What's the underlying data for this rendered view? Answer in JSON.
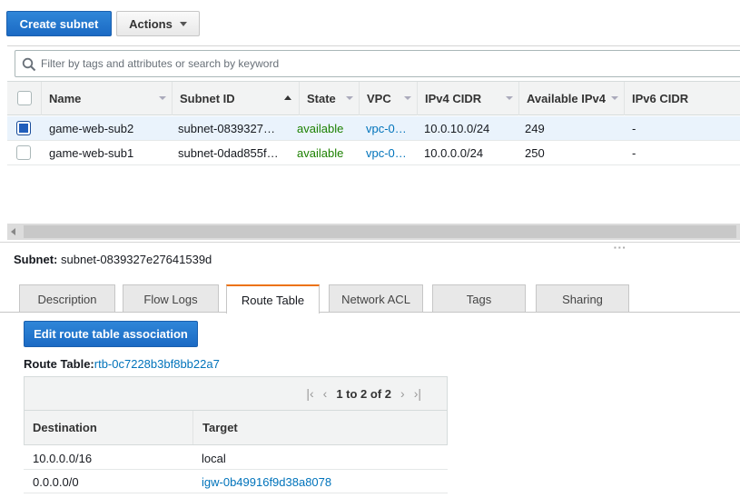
{
  "toolbar": {
    "create_label": "Create subnet",
    "actions_label": "Actions"
  },
  "search": {
    "placeholder": "Filter by tags and attributes or search by keyword"
  },
  "grid": {
    "columns": [
      "Name",
      "Subnet ID",
      "State",
      "VPC",
      "IPv4 CIDR",
      "Available IPv4",
      "IPv6 CIDR"
    ],
    "rows": [
      {
        "selected": true,
        "name": "game-web-sub2",
        "subnet_id": "subnet-0839327…",
        "state": "available",
        "vpc": "vpc-0…",
        "ipv4_cidr": "10.0.10.0/24",
        "available_ipv4": "249",
        "ipv6_cidr": "-"
      },
      {
        "selected": false,
        "name": "game-web-sub1",
        "subnet_id": "subnet-0dad855f…",
        "state": "available",
        "vpc": "vpc-0…",
        "ipv4_cidr": "10.0.0.0/24",
        "available_ipv4": "250",
        "ipv6_cidr": "-"
      }
    ]
  },
  "detail": {
    "subnet_label": "Subnet:",
    "subnet_value": "subnet-0839327e27641539d",
    "tabs": [
      "Description",
      "Flow Logs",
      "Route Table",
      "Network ACL",
      "Tags",
      "Sharing"
    ],
    "active_tab": "Route Table",
    "edit_button": "Edit route table association",
    "route_table_label": "Route Table:",
    "route_table_id": "rtb-0c7228b3bf8bb22a7",
    "pager_text": "1 to 2 of 2",
    "columns": [
      "Destination",
      "Target"
    ],
    "routes": [
      {
        "destination": "10.0.0.0/16",
        "target": "local",
        "target_is_link": false
      },
      {
        "destination": "0.0.0.0/0",
        "target": "igw-0b49916f9d38a8078",
        "target_is_link": true
      }
    ]
  },
  "colors": {
    "primary": "#1b6ac4",
    "status_green": "#1d8102",
    "link_blue": "#0073bb",
    "active_tab_accent": "#ec7211"
  }
}
